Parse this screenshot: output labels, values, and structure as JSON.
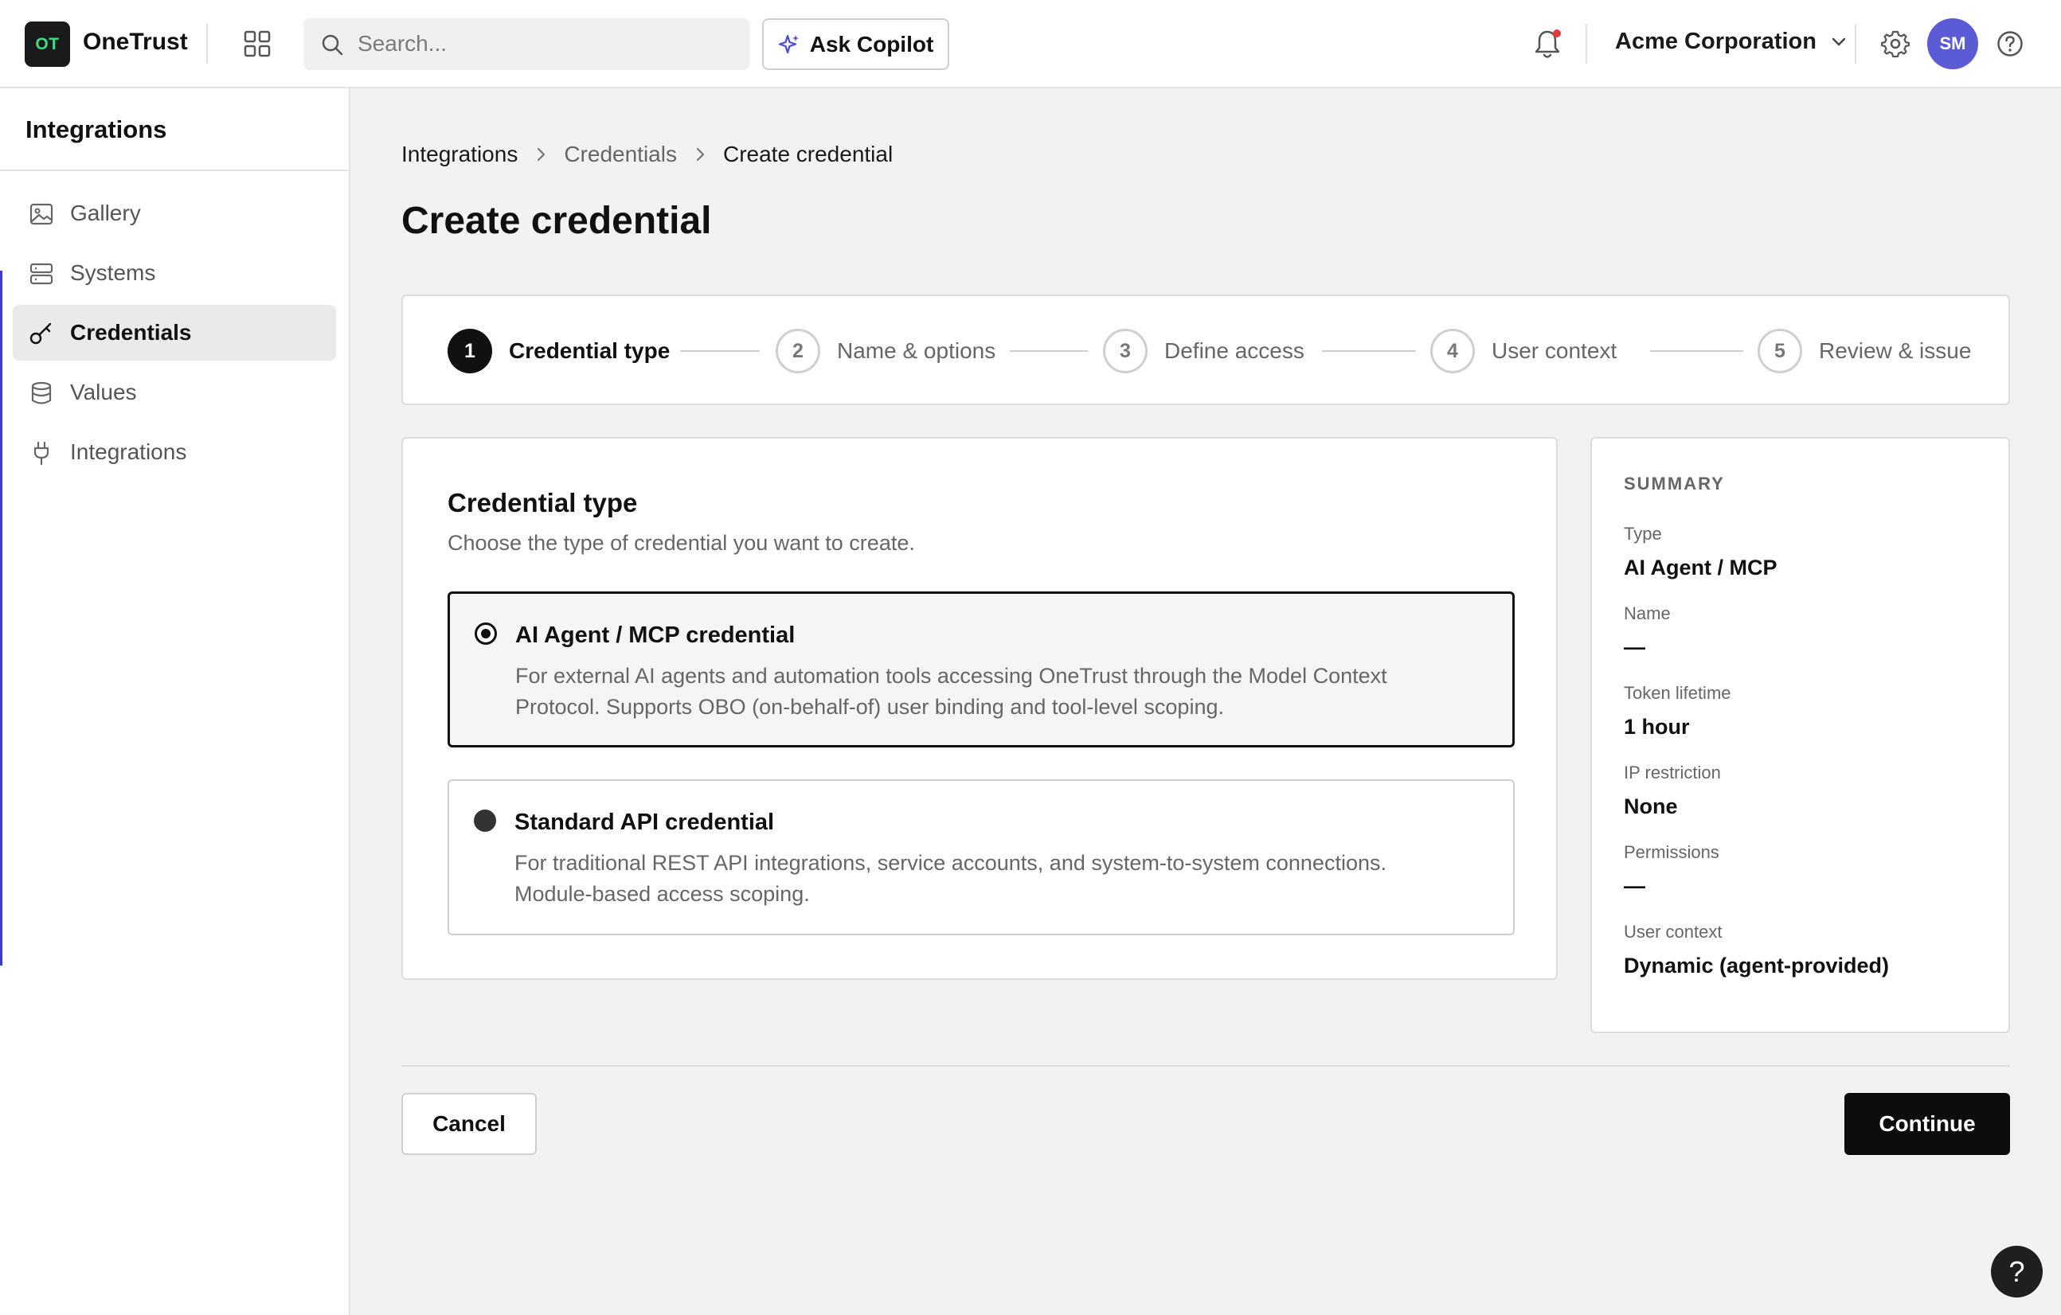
{
  "app": {
    "logo_text": "OT",
    "brand": "OneTrust",
    "search_placeholder": "Search...",
    "copilot_label": "Ask Copilot",
    "org_name": "Acme Corporation",
    "avatar_initials": "SM",
    "accent_color": "#5b5bd6"
  },
  "sidebar": {
    "title": "Integrations",
    "items": [
      {
        "label": "Gallery",
        "icon": "image-icon",
        "active": false
      },
      {
        "label": "Systems",
        "icon": "server-icon",
        "active": false
      },
      {
        "label": "Credentials",
        "icon": "key-icon",
        "active": true
      },
      {
        "label": "Values",
        "icon": "database-icon",
        "active": false
      },
      {
        "label": "Integrations",
        "icon": "plug-icon",
        "active": false
      }
    ]
  },
  "breadcrumb": [
    "Integrations",
    "Credentials",
    "Create credential"
  ],
  "page_title": "Create credential",
  "stepper": {
    "steps": [
      {
        "num": "1",
        "label": "Credential type",
        "state": "current"
      },
      {
        "num": "2",
        "label": "Name & options",
        "state": "upcoming"
      },
      {
        "num": "3",
        "label": "Define access",
        "state": "upcoming"
      },
      {
        "num": "4",
        "label": "User context",
        "state": "upcoming"
      },
      {
        "num": "5",
        "label": "Review & issue",
        "state": "upcoming"
      }
    ]
  },
  "credential_type": {
    "title": "Credential type",
    "subtitle": "Choose the type of credential you want to create.",
    "options": [
      {
        "title": "AI Agent / MCP credential",
        "description": "For external AI agents and automation tools accessing OneTrust through the Model Context Protocol. Supports OBO (on-behalf-of) user binding and tool-level scoping.",
        "selected": true
      },
      {
        "title": "Standard API credential",
        "description": "For traditional REST API integrations, service accounts, and system-to-system connections. Module-based access scoping.",
        "selected": false
      }
    ]
  },
  "summary": {
    "heading": "SUMMARY",
    "rows": [
      {
        "label": "Type",
        "value": "AI Agent / MCP"
      },
      {
        "label": "Name",
        "value": "—"
      },
      {
        "label": "Token lifetime",
        "value": "1 hour"
      },
      {
        "label": "IP restriction",
        "value": "None"
      },
      {
        "label": "Permissions",
        "value": "—"
      },
      {
        "label": "User context",
        "value": "Dynamic (agent-provided)"
      }
    ]
  },
  "footer": {
    "cancel_label": "Cancel",
    "continue_label": "Continue"
  },
  "help_fab": "?"
}
